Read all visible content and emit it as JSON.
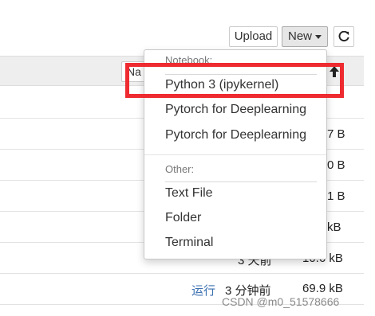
{
  "toolbar": {
    "upload_label": "Upload",
    "new_label": "New",
    "refresh_icon": "refresh-icon"
  },
  "list": {
    "name_header_partial": "Na",
    "rows": [
      {
        "size": "7 B"
      },
      {
        "size": "0 B"
      },
      {
        "size": "1 B"
      },
      {
        "size": "kB"
      },
      {
        "modified_partial": "3 天前",
        "size": "10.6 kB"
      },
      {
        "status": "运行",
        "modified": "3 分钟前",
        "size": "69.9 kB"
      }
    ]
  },
  "dropdown": {
    "notebook_header": "Notebook:",
    "notebook_items": [
      "Python 3 (ipykernel)",
      "Pytorch for Deeplearning",
      "Pytorch for Deeplearning"
    ],
    "other_header": "Other:",
    "other_items": [
      "Text File",
      "Folder",
      "Terminal"
    ]
  },
  "colors": {
    "highlight": "#ee2b30",
    "header_bg": "#eeeeee"
  },
  "watermark": "CSDN @m0_51578666"
}
